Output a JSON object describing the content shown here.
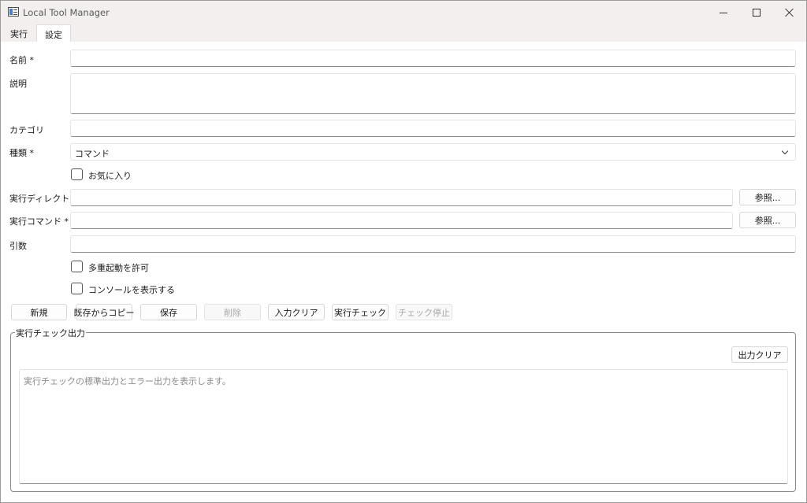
{
  "window": {
    "title": "Local Tool Manager"
  },
  "tabs": [
    {
      "label": "実行"
    },
    {
      "label": "設定"
    }
  ],
  "form": {
    "name_label": "名前 *",
    "name_value": "",
    "description_label": "説明",
    "description_value": "",
    "category_label": "カテゴリ",
    "category_value": "",
    "type_label": "種類 *",
    "type_value": "コマンド",
    "favorite_label": "お気に入り",
    "favorite_checked": false,
    "workdir_label": "実行ディレクトリ",
    "workdir_value": "",
    "workdir_browse": "参照...",
    "command_label": "実行コマンド *",
    "command_value": "",
    "command_browse": "参照...",
    "args_label": "引数",
    "args_value": "",
    "multi_launch_label": "多重起動を許可",
    "multi_launch_checked": false,
    "show_console_label": "コンソールを表示する",
    "show_console_checked": false
  },
  "actions": {
    "new": "新規",
    "copy_existing": "既存からコピー",
    "save": "保存",
    "delete": "削除",
    "clear_input": "入力クリア",
    "run_check": "実行チェック",
    "stop_check": "チェック停止"
  },
  "output": {
    "group_title": "実行チェック出力",
    "clear_button": "出力クリア",
    "placeholder": "実行チェックの標準出力とエラー出力を表示します。"
  }
}
